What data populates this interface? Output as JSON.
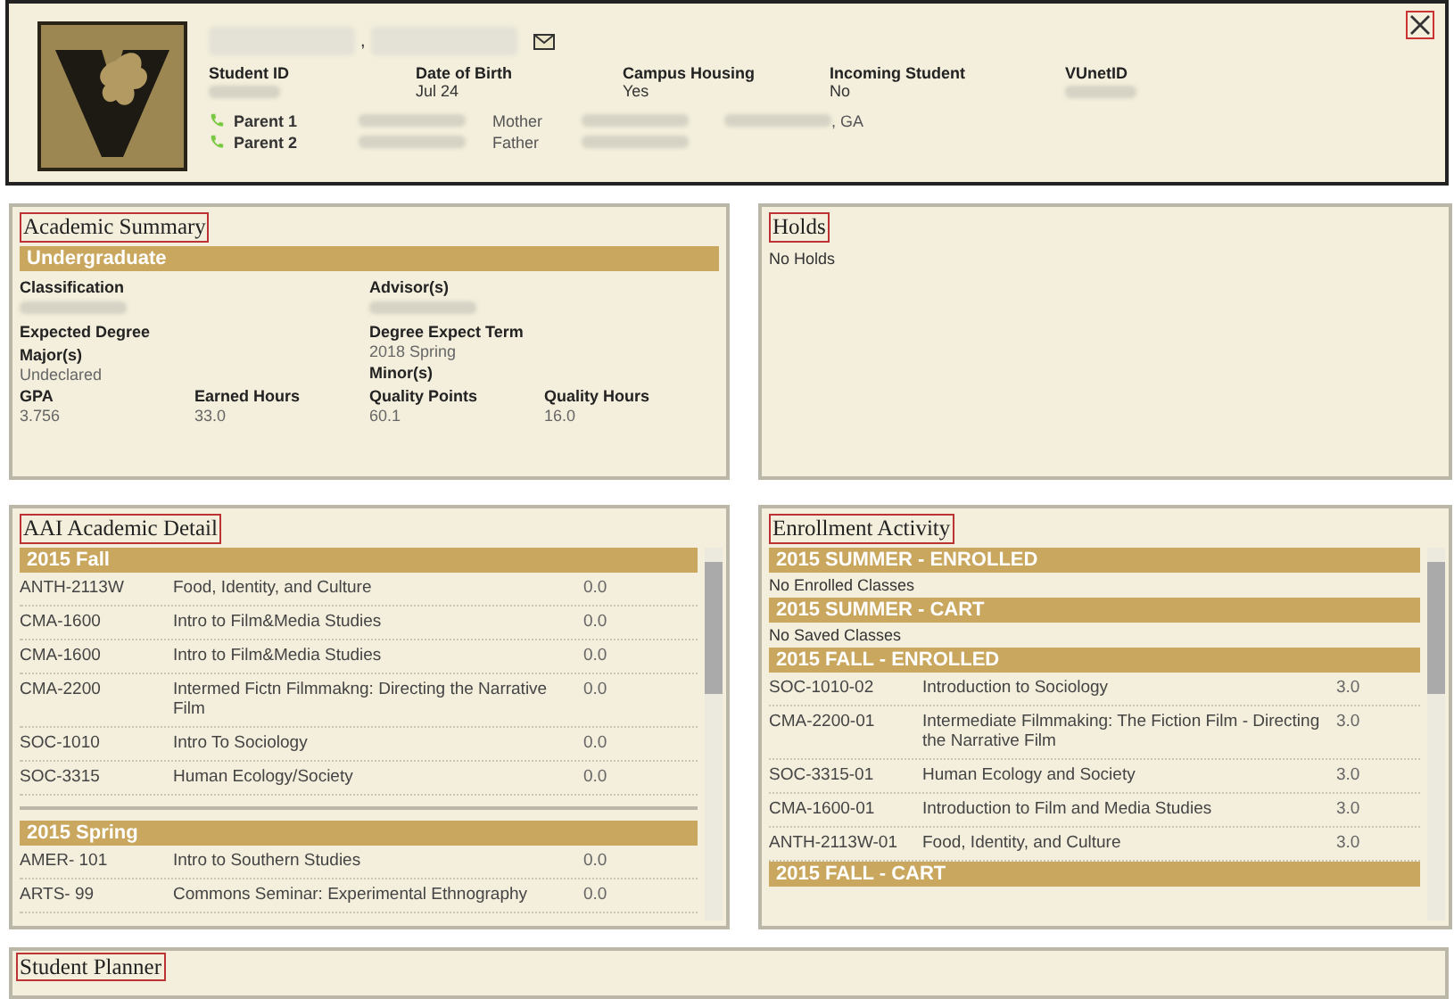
{
  "header": {
    "name_separator": ",",
    "fields": [
      {
        "label": "Student ID",
        "blurred": true
      },
      {
        "label": "Date of Birth",
        "value": "Jul 24",
        "blurred": false
      },
      {
        "label": "Campus Housing",
        "value": "Yes",
        "blurred": false
      },
      {
        "label": "Incoming Student",
        "value": "No",
        "blurred": false
      },
      {
        "label": "VUnetID",
        "blurred": true
      }
    ],
    "parents": [
      {
        "label": "Parent 1",
        "relation": "Mother",
        "location": ", GA"
      },
      {
        "label": "Parent 2",
        "relation": "Father"
      }
    ]
  },
  "academic_summary": {
    "title": "Academic Summary",
    "band": "Undergraduate",
    "left": [
      {
        "label": "Classification",
        "blurred": true
      },
      {
        "label": "Expected Degree",
        "blurred": false
      },
      {
        "label": "Major(s)",
        "value": "Undeclared",
        "blurred": false
      }
    ],
    "right": [
      {
        "label": "Advisor(s)",
        "blurred": true
      },
      {
        "label": "Degree Expect Term",
        "value": "2018 Spring",
        "blurred": false
      },
      {
        "label": "Minor(s)",
        "blurred": false
      }
    ],
    "stats": [
      {
        "label": "GPA",
        "value": "3.756"
      },
      {
        "label": "Earned Hours",
        "value": "33.0"
      },
      {
        "label": "Quality Points",
        "value": "60.1"
      },
      {
        "label": "Quality Hours",
        "value": "16.0"
      }
    ]
  },
  "holds": {
    "title": "Holds",
    "text": "No Holds"
  },
  "academic_detail": {
    "title": "AAI Academic Detail",
    "terms": [
      {
        "heading": "2015 Fall",
        "courses": [
          {
            "code": "ANTH-2113W",
            "title": "Food, Identity, and Culture",
            "hours": "0.0"
          },
          {
            "code": "CMA-1600",
            "title": "Intro to Film&Media Studies",
            "hours": "0.0"
          },
          {
            "code": "CMA-1600",
            "title": "Intro to Film&Media Studies",
            "hours": "0.0"
          },
          {
            "code": "CMA-2200",
            "title": "Intermed Fictn Filmmakng: Directing the Narrative Film",
            "hours": "0.0"
          },
          {
            "code": "SOC-1010",
            "title": "Intro To Sociology",
            "hours": "0.0"
          },
          {
            "code": "SOC-3315",
            "title": "Human Ecology/Society",
            "hours": "0.0"
          }
        ]
      },
      {
        "heading": "2015 Spring",
        "courses": [
          {
            "code": "AMER- 101",
            "title": "Intro to Southern Studies",
            "hours": "0.0"
          },
          {
            "code": "ARTS- 99",
            "title": "Commons Seminar: Experimental Ethnography",
            "hours": "0.0"
          }
        ]
      }
    ]
  },
  "enrollment_activity": {
    "title": "Enrollment Activity",
    "sections": [
      {
        "heading": "2015 SUMMER - ENROLLED",
        "empty_text": "No Enrolled Classes"
      },
      {
        "heading": "2015 SUMMER - CART",
        "empty_text": "No Saved Classes"
      },
      {
        "heading": "2015 FALL - ENROLLED",
        "courses": [
          {
            "code": "SOC-1010-02",
            "title": "Introduction to Sociology",
            "hours": "3.0"
          },
          {
            "code": "CMA-2200-01",
            "title": "Intermediate Filmmaking: The Fiction Film - Directing the Narrative Film",
            "hours": "3.0"
          },
          {
            "code": "SOC-3315-01",
            "title": "Human Ecology and Society",
            "hours": "3.0"
          },
          {
            "code": "CMA-1600-01",
            "title": "Introduction to Film and Media Studies",
            "hours": "3.0"
          },
          {
            "code": "ANTH-2113W-01",
            "title": "Food, Identity, and Culture",
            "hours": "3.0"
          }
        ]
      },
      {
        "heading": "2015 FALL - CART"
      }
    ]
  },
  "student_planner": {
    "title": "Student Planner"
  }
}
